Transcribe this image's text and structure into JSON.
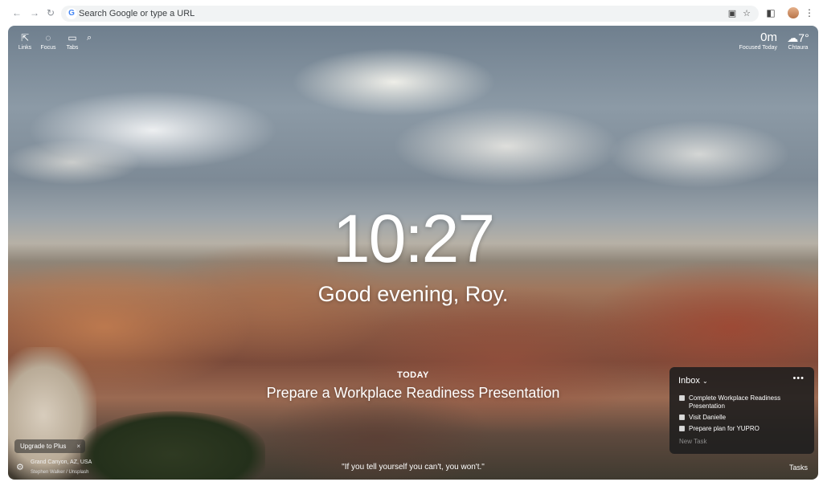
{
  "browser": {
    "address_placeholder": "Search Google or type a URL"
  },
  "topleft": {
    "items": [
      {
        "label": "Links",
        "icon": "external-link-icon"
      },
      {
        "label": "Focus",
        "icon": "chat-icon"
      },
      {
        "label": "Tabs",
        "icon": "tabs-icon"
      }
    ]
  },
  "focus_stat": {
    "value": "0m",
    "label": "Focused Today"
  },
  "weather": {
    "temp": "7°",
    "location": "Chtaura",
    "icon": "cloud-sun-icon"
  },
  "clock": {
    "time": "10:27"
  },
  "greeting": "Good evening, Roy.",
  "today": {
    "label": "TODAY",
    "task": "Prepare a Workplace Readiness Presentation"
  },
  "quote": "\"If you tell yourself you can't, you won't.\"",
  "upgrade": {
    "label": "Upgrade to Plus",
    "close": "×"
  },
  "photo": {
    "location": "Grand Canyon, AZ, USA",
    "credit": "Stephen Walker / Unsplash"
  },
  "tasks": {
    "header": "Inbox",
    "menu": "•••",
    "items": [
      "Complete Workplace Readiness Presentation",
      "Visit Danielle",
      "Prepare plan for YUPRO"
    ],
    "new_task_placeholder": "New Task",
    "button_label": "Tasks"
  }
}
